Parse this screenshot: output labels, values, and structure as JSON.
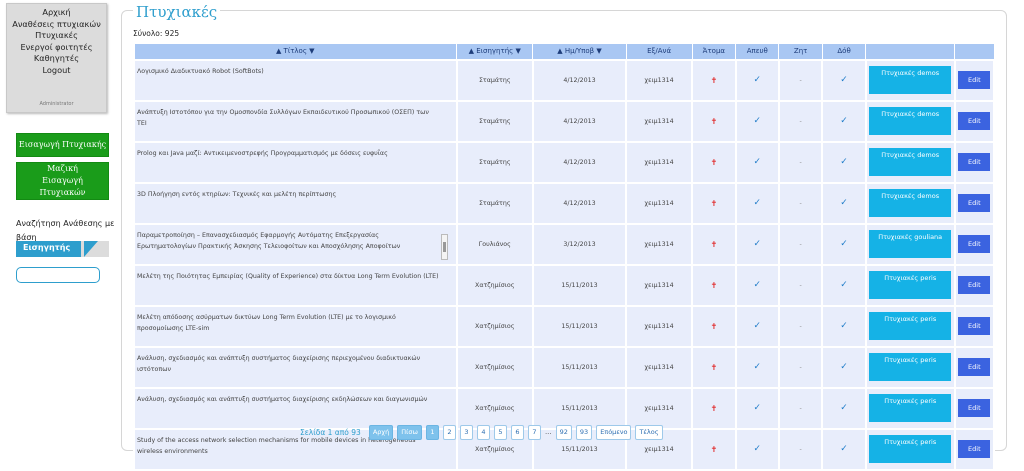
{
  "menu": {
    "items": [
      "Αρχική",
      "Αναθέσεις πτυχιακών",
      "Πτυχιακές",
      "Ενεργοί φοιτητές",
      "Καθηγητές",
      "Logout"
    ],
    "role": "Administrator"
  },
  "sidebar": {
    "insert_button": "Εισαγωγή Πτυχιακής",
    "bulk_button": "Μαζική Εισαγωγή Πτυχιακών",
    "search_label": "Αναζήτηση Ανάθεσης με βάση",
    "search_field": "Εισηγητής",
    "search_value": ""
  },
  "page": {
    "title": "Πτυχιακές",
    "total": "Σύνολο: 925"
  },
  "table": {
    "headers": [
      "▲ Τίτλος ▼",
      "▲ Εισηγητής ▼",
      "▲ Ημ/Υποβ ▼",
      "Εξ/Ανά",
      "Άτομα",
      "Απευθ",
      "Ζητ",
      "Δόθ",
      "",
      ""
    ],
    "rows": [
      {
        "title": "Λογισμικό Διαδικτυακό Robot (SoftBots)",
        "supervisor": "Σταμάτης",
        "date": "4/12/2013",
        "semester": "χειμ1314",
        "persons": "✝",
        "direct": "✓",
        "requested": "-",
        "given": "✓",
        "group": "Πτυχιακές demos",
        "edit": "Edit"
      },
      {
        "title": "Ανάπτυξη Ιστοτόπου για την Ομοσπονδία Συλλόγων Εκπαιδευτικού Προσωπικού (ΟΣΕΠ) των ΤΕΙ",
        "supervisor": "Σταμάτης",
        "date": "4/12/2013",
        "semester": "χειμ1314",
        "persons": "✝",
        "direct": "✓",
        "requested": "-",
        "given": "✓",
        "group": "Πτυχιακές demos",
        "edit": "Edit"
      },
      {
        "title": "Prolog και Java μαζί: Αντικειμενοστρεφής Προγραμματισμός με δόσεις ευφυΐας",
        "supervisor": "Σταμάτης",
        "date": "4/12/2013",
        "semester": "χειμ1314",
        "persons": "✝",
        "direct": "✓",
        "requested": "-",
        "given": "✓",
        "group": "Πτυχιακές demos",
        "edit": "Edit"
      },
      {
        "title": "3D Πλοήγηση εντός κτηρίων: Τεχνικές και μελέτη περίπτωσης",
        "supervisor": "Σταμάτης",
        "date": "4/12/2013",
        "semester": "χειμ1314",
        "persons": "✝",
        "direct": "✓",
        "requested": "-",
        "given": "✓",
        "group": "Πτυχιακές demos",
        "edit": "Edit"
      },
      {
        "title": "Παραμετροποίηση – Επανασχεδιασμός Εφαρμογής Αυτόματης Επεξεργασίας Ερωτηματολογίων Πρακτικής Άσκησης Τελειοφοίτων και Αποσχόλησης Αποφοίτων",
        "supervisor": "Γουλιάνος",
        "date": "3/12/2013",
        "semester": "χειμ1314",
        "persons": "✝",
        "direct": "✓",
        "requested": "-",
        "given": "✓",
        "group": "Πτυχιακές gouliana",
        "edit": "Edit"
      },
      {
        "title": "Μελέτη της Ποιότητας Εμπειρίας (Quality of Experience) στα δίκτυα Long Term Evolution (LTE)",
        "supervisor": "Χατζημίσιος",
        "date": "15/11/2013",
        "semester": "χειμ1314",
        "persons": "✝",
        "direct": "✓",
        "requested": "-",
        "given": "✓",
        "group": "Πτυχιακές peris",
        "edit": "Edit"
      },
      {
        "title": "Μελέτη απόδοσης ασύρματων δικτύων Long Term Evolution (LTE) με το λογισμικό προσομοίωσης LTE-sim",
        "supervisor": "Χατζημίσιος",
        "date": "15/11/2013",
        "semester": "χειμ1314",
        "persons": "✝",
        "direct": "✓",
        "requested": "-",
        "given": "✓",
        "group": "Πτυχιακές peris",
        "edit": "Edit"
      },
      {
        "title": "Ανάλυση, σχεδιασμός και ανάπτυξη συστήματος διαχείρισης περιεχομένου διαδικτυακών ιστότοπων",
        "supervisor": "Χατζημίσιος",
        "date": "15/11/2013",
        "semester": "χειμ1314",
        "persons": "✝",
        "direct": "✓",
        "requested": "-",
        "given": "✓",
        "group": "Πτυχιακές peris",
        "edit": "Edit"
      },
      {
        "title": "Ανάλυση, σχεδιασμός και ανάπτυξη συστήματος διαχείρισης εκδηλώσεων και διαγωνισμών",
        "supervisor": "Χατζημίσιος",
        "date": "15/11/2013",
        "semester": "χειμ1314",
        "persons": "✝",
        "direct": "✓",
        "requested": "-",
        "given": "✓",
        "group": "Πτυχιακές peris",
        "edit": "Edit"
      },
      {
        "title": "Study of the access network selection mechanisms for mobile devices in heterogeneous wireless environments",
        "supervisor": "Χατζημίσιος",
        "date": "15/11/2013",
        "semester": "χειμ1314",
        "persons": "✝",
        "direct": "✓",
        "requested": "-",
        "given": "✓",
        "group": "Πτυχιακές peris",
        "edit": "Edit"
      }
    ]
  },
  "pager": {
    "info": "Σελίδα 1 από 93",
    "first": "Αρχή",
    "prev": "Πίσω",
    "pages_before": [
      "1",
      "2",
      "3",
      "4",
      "5",
      "6",
      "7"
    ],
    "dots": "...",
    "pages_after": [
      "92",
      "93"
    ],
    "next": "Επόμενο",
    "last": "Τέλος",
    "current": "1"
  }
}
